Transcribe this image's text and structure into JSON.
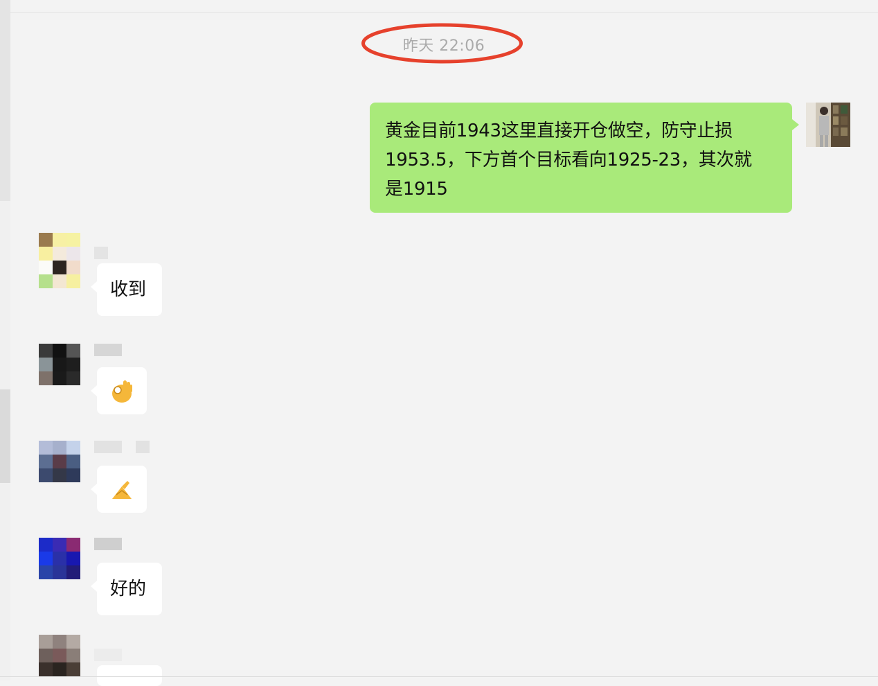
{
  "timestamp": "昨天 22:06",
  "annotation": {
    "color": "#e6412c",
    "shape": "ellipse"
  },
  "outgoing": {
    "lines": [
      "黄金目前1943这里直接开仓做空，防守止损",
      "1953.5，下方首个目标看向1925-23，其次就",
      "是1915"
    ],
    "bubble_color": "#a9ea7a"
  },
  "incoming": [
    {
      "text": "收到",
      "type": "text"
    },
    {
      "text": "",
      "type": "emoji",
      "icon": "ok-hand-icon"
    },
    {
      "text": "",
      "type": "emoji",
      "icon": "pinching-hand-icon"
    },
    {
      "text": "好的",
      "type": "text"
    },
    {
      "text": "",
      "type": "partial"
    }
  ],
  "colors": {
    "background": "#f3f3f3",
    "incoming_bubble": "#ffffff",
    "timestamp_text": "#aaaaaa"
  }
}
